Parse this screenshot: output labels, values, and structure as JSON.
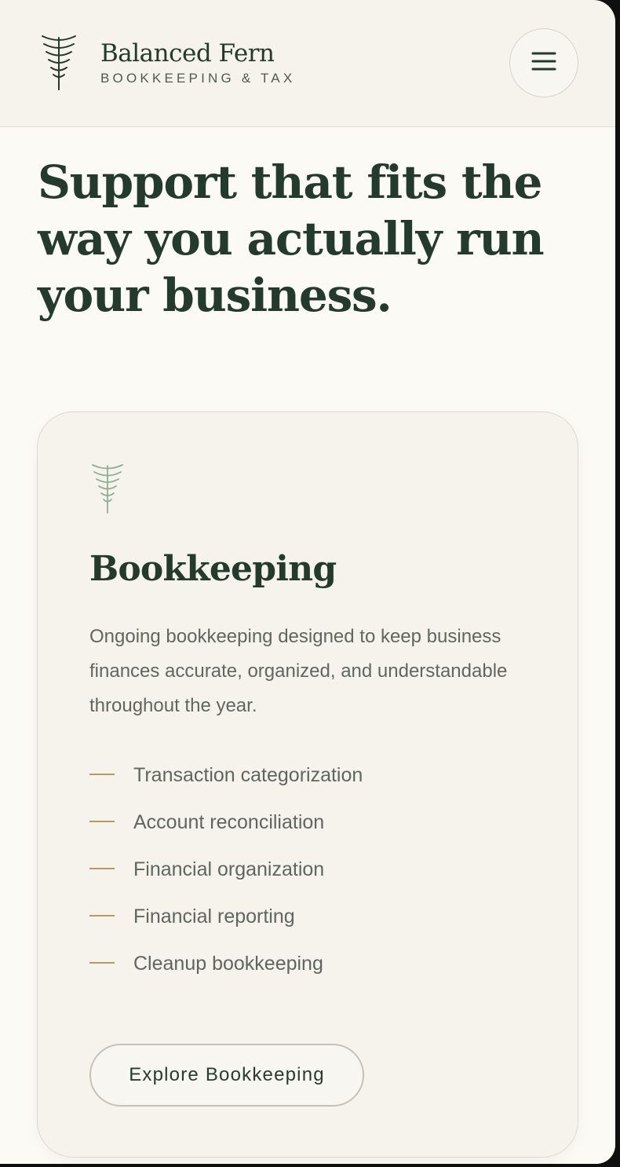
{
  "brand": {
    "name": "Balanced Fern",
    "tagline": "BOOKKEEPING & TAX",
    "logo_icon": "fern-icon"
  },
  "header": {
    "menu_icon": "hamburger-menu-icon"
  },
  "hero": {
    "title": "Support that fits the way you actually run your business."
  },
  "service_card": {
    "icon": "fern-icon",
    "title": "Bookkeeping",
    "description": "Ongoing bookkeeping designed to keep business finances accurate, organized, and understandable throughout the year.",
    "features": [
      "Transaction categorization",
      "Account reconciliation",
      "Financial organization",
      "Financial reporting",
      "Cleanup bookkeeping"
    ],
    "cta_label": "Explore Bookkeeping"
  },
  "colors": {
    "primary_green": "#233a2c",
    "background": "#fcfaf5",
    "card_background": "#f6f3ed",
    "accent_gold": "#b89a63",
    "icon_sage": "#8fae92"
  }
}
